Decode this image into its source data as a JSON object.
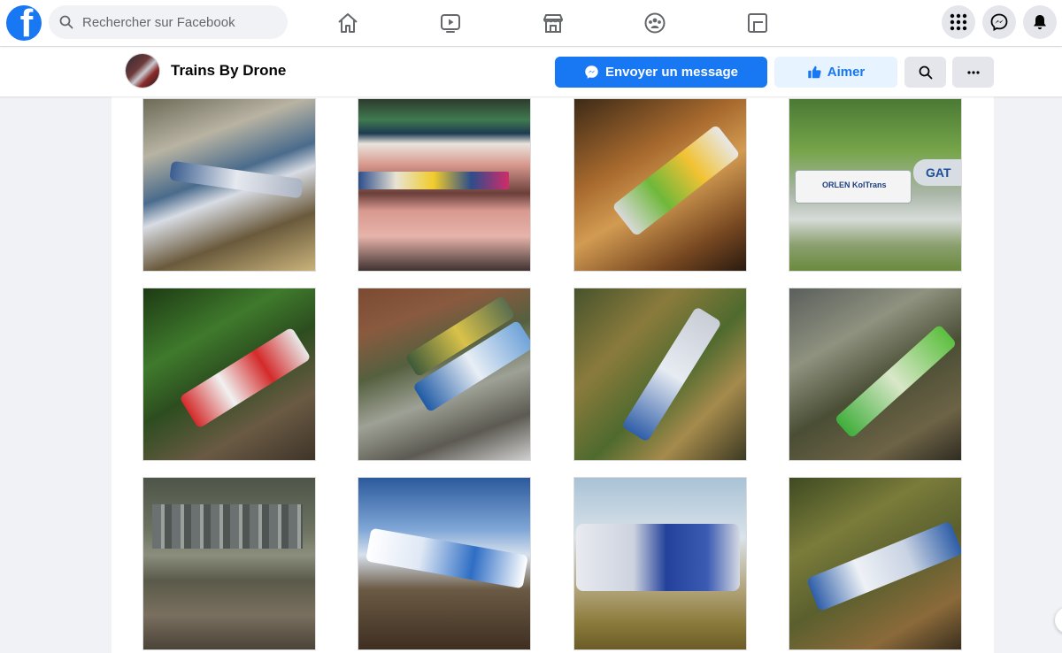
{
  "topbar": {
    "logo": "f",
    "search_placeholder": "Rechercher sur Facebook",
    "nav": [
      "home-icon",
      "watch-icon",
      "marketplace-icon",
      "groups-icon",
      "gaming-icon"
    ],
    "right": [
      "menu-grid-icon",
      "messenger-icon",
      "notifications-bell-icon"
    ]
  },
  "page": {
    "name": "Trains By Drone",
    "message_label": "Envoyer un message",
    "like_label": "Aimer"
  },
  "colors": {
    "brand": "#1877f2",
    "like_bg": "#e7f3ff",
    "page_bg": "#f0f2f5"
  },
  "photos": {
    "count": 12,
    "visible_texts": [
      "ORLEN KolTrans",
      "GAT"
    ]
  }
}
